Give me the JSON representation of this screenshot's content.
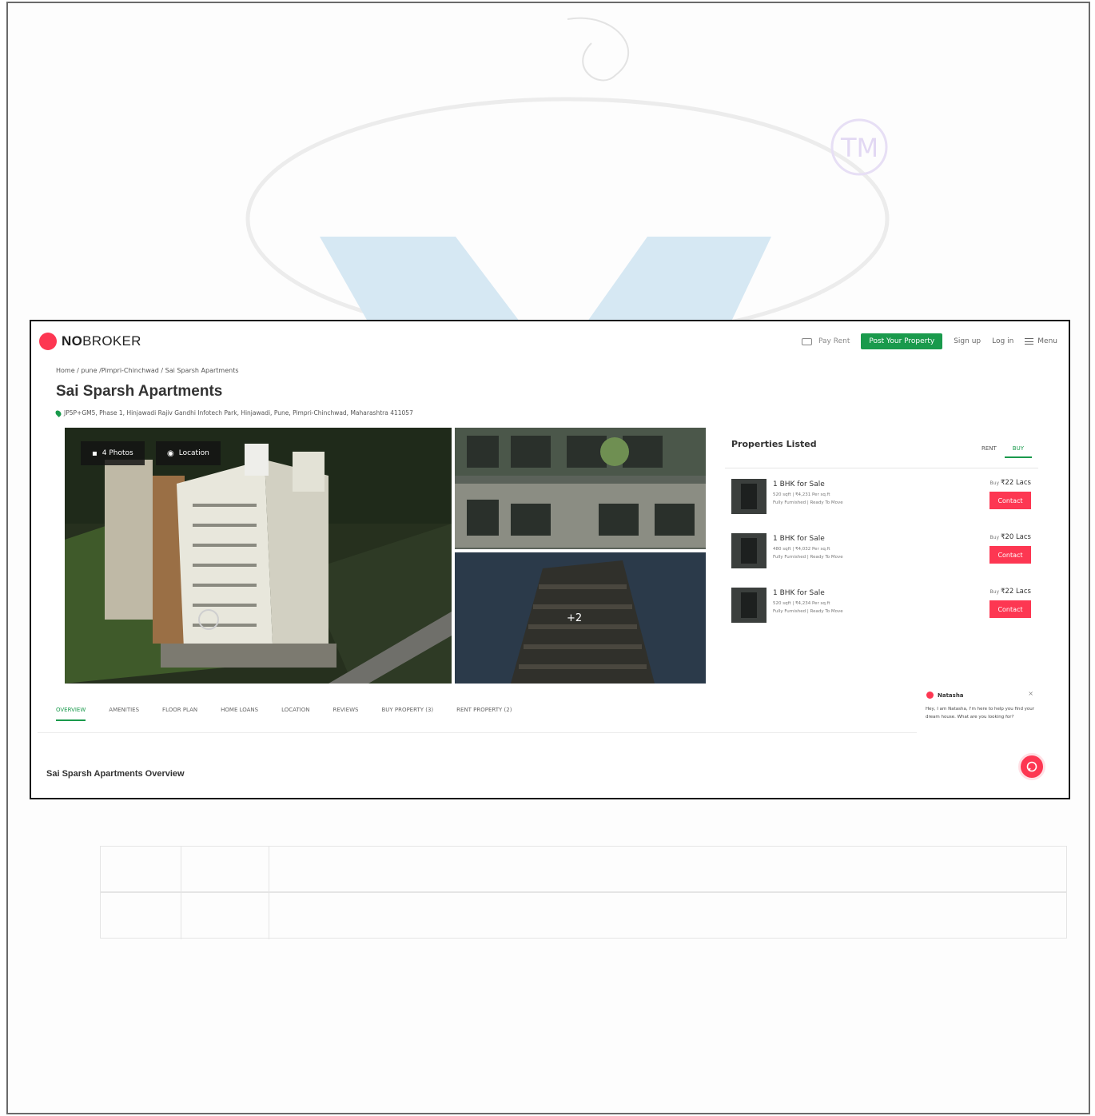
{
  "site": {
    "logo_bold": "NO",
    "logo_rest": "BROKER",
    "nav": {
      "pay_rent": "Pay Rent",
      "post_property": "Post Your Property",
      "sign_up": "Sign up",
      "log_in": "Log in",
      "menu": "Menu"
    }
  },
  "breadcrumb": "Home / pune /Pimpri-Chinchwad / Sai Sparsh Apartments",
  "property": {
    "title": "Sai Sparsh Apartments",
    "address": "JP5P+GM5, Phase 1, Hinjawadi Rajiv Gandhi Infotech Park, Hinjawadi, Pune, Pimpri-Chinchwad, Maharashtra 411057"
  },
  "gallery": {
    "photos_label": "4 Photos",
    "location_label": "Location",
    "more_count": "+2"
  },
  "listings": {
    "heading": "Properties Listed",
    "tabs": [
      "RENT",
      "BUY"
    ],
    "items": [
      {
        "name": "1 BHK for Sale",
        "area": "520 sqft | ₹4,231 Per sq.ft",
        "status": "Fully Furnished | Ready To Move",
        "price_label": "Buy",
        "price": "₹22 Lacs",
        "cta": "Contact"
      },
      {
        "name": "1 BHK for Sale",
        "area": "480 sqft | ₹4,032 Per sq.ft",
        "status": "Fully Furnished | Ready To Move",
        "price_label": "Buy",
        "price": "₹20 Lacs",
        "cta": "Contact"
      },
      {
        "name": "1 BHK for Sale",
        "area": "520 sqft | ₹4,234 Per sq.ft",
        "status": "Fully Furnished | Ready To Move",
        "price_label": "Buy",
        "price": "₹22 Lacs",
        "cta": "Contact"
      }
    ]
  },
  "chat": {
    "agent": "Natasha",
    "message": "Hey, I am Natasha, I'm here to help you find your dream house. What are you looking for?"
  },
  "tabs": [
    "OVERVIEW",
    "AMENITIES",
    "FLOOR PLAN",
    "HOME LOANS",
    "LOCATION",
    "REVIEWS",
    "BUY PROPERTY (3)",
    "RENT PROPERTY (2)"
  ],
  "overview_heading": "Sai Sparsh Apartments Overview",
  "colors": {
    "brand": "#fd3752",
    "accent_green": "#1a9a4c"
  }
}
